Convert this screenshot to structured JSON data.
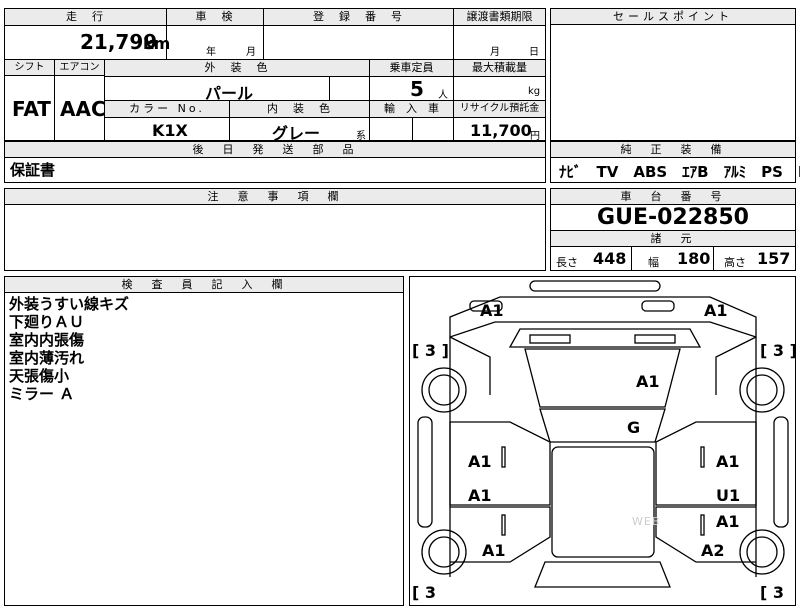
{
  "labels": {
    "mileage": "走　行",
    "inspection": "車　検",
    "registration_no": "登　録　番　号",
    "transfer_doc_date": "譲渡書類期限",
    "sales_points": "セールスポイント",
    "shift": "シフト",
    "aircon": "エアコン",
    "exterior_color": "外　装　色",
    "capacity": "乗車定員",
    "max_load": "最大積載量",
    "color_no": "カラー No.",
    "interior_color": "内　装　色",
    "import": "輸　入　車",
    "recycle_fee": "リサイクル預託金",
    "later_parts": "後　日　発　送　部　品",
    "equipment": "純　正　装　備",
    "caution": "注　意　事　項　欄",
    "chassis_no": "車　台　番　号",
    "dimensions": "諸　元",
    "inspector_notes": "検　査　員　記　入　欄"
  },
  "values": {
    "mileage": "21,799",
    "mileage_unit": "km",
    "year": "年",
    "month": "月",
    "transfer_month": "月",
    "transfer_day": "日",
    "shift": "FAT",
    "aircon": "AAC",
    "exterior_color": "パール",
    "capacity": "5",
    "capacity_unit": "人",
    "load_unit": "kg",
    "color_no": "K1X",
    "interior_color": "グレー",
    "interior_suffix": "系",
    "recycle_fee": "11,700",
    "recycle_unit": "円",
    "later_parts": "保証書",
    "equipment": "ﾅﾋﾞ　TV　ABS　ｴｱB　ｱﾙﾐ　PS　PW",
    "chassis_no": "GUE-022850",
    "length_label": "長さ",
    "length": "448",
    "width_label": "幅",
    "width": "180",
    "height_label": "高さ",
    "height": "157"
  },
  "inspector_notes": [
    "外装うすい線キズ",
    "下廻りＡＵ",
    "室内内張傷",
    "室内薄汚れ",
    "天張傷小",
    "ミラー Ａ"
  ],
  "damage_marks": {
    "front_left_corner": "A1",
    "front_right_corner": "A1",
    "hood": "A1",
    "windshield": "G",
    "left_front_door": "A1",
    "right_front_door": "A1",
    "left_rear_door": "A1",
    "right_rear_door_1": "U1",
    "right_rear_door_2": "A1",
    "left_rear_fender": "A1",
    "right_rear_fender": "A2",
    "tire_front_left": "[ 3 ]",
    "tire_front_right": "[ 3 ]",
    "tire_rear_left": "[ 3",
    "tire_rear_right": "[ 3"
  },
  "watermark": "WEB"
}
